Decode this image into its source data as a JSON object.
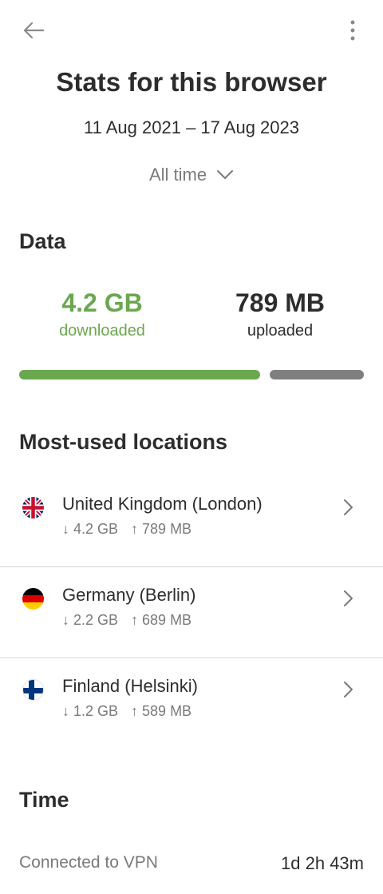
{
  "header": {
    "back_icon": "arrow-left-icon",
    "menu_icon": "more-vertical-icon",
    "title": "Stats for this browser",
    "date_range": "11 Aug 2021 – 17 Aug 2023",
    "range_selector": {
      "label": "All time",
      "icon": "chevron-down-icon"
    }
  },
  "data_section": {
    "heading": "Data",
    "downloaded": {
      "value": "4.2 GB",
      "caption": "downloaded"
    },
    "uploaded": {
      "value": "789 MB",
      "caption": "uploaded"
    },
    "bar_split": {
      "downloaded_fraction": 0.72,
      "uploaded_fraction": 0.28
    },
    "colors": {
      "downloaded": "#6aa84f",
      "uploaded": "#7f7f7f"
    }
  },
  "locations": {
    "heading": "Most-used locations",
    "items": [
      {
        "name": "United Kingdom (London)",
        "flag": "uk-flag-icon",
        "down": "↓ 4.2 GB",
        "up": "↑ 789 MB"
      },
      {
        "name": "Germany (Berlin)",
        "flag": "germany-flag-icon",
        "down": "↓ 2.2 GB",
        "up": "↑ 689 MB"
      },
      {
        "name": "Finland (Helsinki)",
        "flag": "finland-flag-icon",
        "down": "↓ 1.2 GB",
        "up": "↑ 589 MB"
      }
    ]
  },
  "time_section": {
    "heading": "Time",
    "connected_label": "Connected to VPN",
    "connected_value": "1d 2h 43m"
  }
}
